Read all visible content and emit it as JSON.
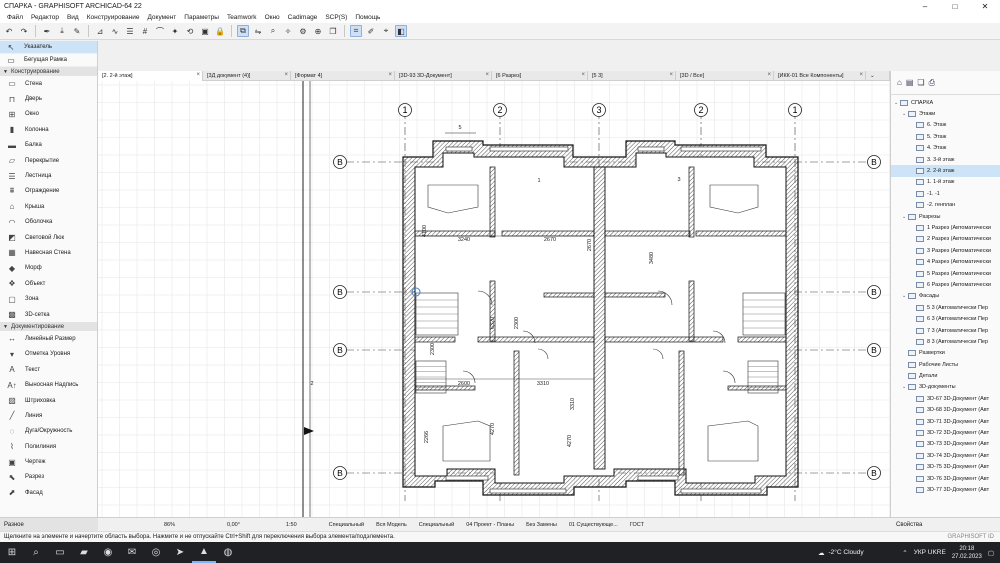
{
  "window": {
    "title": "СПАРКА - GRAPHISOFT ARCHICAD-64 22"
  },
  "menu": [
    "Файл",
    "Редактор",
    "Вид",
    "Конструирование",
    "Документ",
    "Параметры",
    "Teamwork",
    "Окно",
    "Cadimage",
    "SCP(S)",
    "Помощь"
  ],
  "toolbox": {
    "top_items": [
      {
        "label": "Указатель",
        "icon": "arrow-icon"
      },
      {
        "label": "Бегущая Рамка",
        "icon": "marquee-icon"
      }
    ],
    "sections": [
      {
        "title": "Конструирование",
        "items": [
          "Стена",
          "Дверь",
          "Окно",
          "Колонна",
          "Балка",
          "Перекрытие",
          "Лестница",
          "Ограждение",
          "Крыша",
          "Оболочка",
          "Световой Люк",
          "Навесная Стена",
          "Морф",
          "Объект",
          "Зона",
          "3D-сетка"
        ]
      },
      {
        "title": "Документирование",
        "items": [
          "Линейный Размер",
          "Отметка Уровня",
          "Текст",
          "Выносная Надпись",
          "Штриховка",
          "Линия",
          "Дуга/Окружность",
          "Полилиния",
          "Чертеж",
          "Разрез",
          "Фасад"
        ]
      }
    ],
    "footer": "Разное"
  },
  "tabs": [
    {
      "label": "[2. 2-й этаж]",
      "active": true
    },
    {
      "label": "[3Д документ (4)]"
    },
    {
      "label": "[Формат 4]"
    },
    {
      "label": "[3D-93 3D-Документ]"
    },
    {
      "label": "[6 Разрез]"
    },
    {
      "label": "[5 3]"
    },
    {
      "label": "[3D / Все]"
    },
    {
      "label": "[ИКК-01 Все Компоненты]"
    }
  ],
  "navigator": {
    "root": "СПАРКА",
    "items": [
      {
        "label": "Этажи",
        "level": 1,
        "group": true
      },
      {
        "label": "6. Этаж",
        "level": 2
      },
      {
        "label": "5. Этаж",
        "level": 2
      },
      {
        "label": "4. Этаж",
        "level": 2
      },
      {
        "label": "3. 3-й этаж",
        "level": 2
      },
      {
        "label": "2. 2-й этаж",
        "level": 2,
        "selected": true
      },
      {
        "label": "1. 1-й этаж",
        "level": 2
      },
      {
        "label": "-1. -1",
        "level": 2
      },
      {
        "label": "-2. генплан",
        "level": 2
      },
      {
        "label": "Разрезы",
        "level": 1,
        "group": true
      },
      {
        "label": "1 Разрез (Автоматически",
        "level": 2
      },
      {
        "label": "2 Разрез (Автоматически",
        "level": 2
      },
      {
        "label": "3 Разрез (Автоматически",
        "level": 2
      },
      {
        "label": "4 Разрез (Автоматически",
        "level": 2
      },
      {
        "label": "5 Разрез (Автоматически",
        "level": 2
      },
      {
        "label": "6 Разрез (Автоматически",
        "level": 2
      },
      {
        "label": "Фасады",
        "level": 1,
        "group": true
      },
      {
        "label": "5 3 (Автоматически Пер",
        "level": 2
      },
      {
        "label": "6 3 (Автоматически Пер",
        "level": 2
      },
      {
        "label": "7 3 (Автоматически Пер",
        "level": 2
      },
      {
        "label": "8 3 (Автоматически Пер",
        "level": 2
      },
      {
        "label": "Развертки",
        "level": 1
      },
      {
        "label": "Рабочие Листы",
        "level": 1
      },
      {
        "label": "Детали",
        "level": 1
      },
      {
        "label": "3D-документы",
        "level": 1,
        "group": true
      },
      {
        "label": "3D-67 3D-Документ (Авт",
        "level": 2
      },
      {
        "label": "3D-68 3D-Документ (Авт",
        "level": 2
      },
      {
        "label": "3D-71 3D-Документ (Авт",
        "level": 2
      },
      {
        "label": "3D-72 3D-Документ (Авт",
        "level": 2
      },
      {
        "label": "3D-73 3D-Документ (Авт",
        "level": 2
      },
      {
        "label": "3D-74 3D-Документ (Авт",
        "level": 2
      },
      {
        "label": "3D-75 3D-Документ (Авт",
        "level": 2
      },
      {
        "label": "3D-76 3D-Документ (Авт",
        "level": 2
      },
      {
        "label": "3D-77 3D-Документ (Авт",
        "level": 2
      }
    ],
    "footer": "Свойства"
  },
  "statusbar": {
    "zoom": "86%",
    "angle": "0,00°",
    "scale": "1:50",
    "layer": "Специальный",
    "model": "Вся Модель",
    "pen": "Специальный",
    "view": "04 Проект - Планы",
    "override": "Без Замены",
    "reno": "01 Существующе...",
    "standard": "ГОСТ"
  },
  "hint": "Щелкните на элементе и начертите область выбора. Нажмите и не отпускайте Ctrl+Shift для переключения выбора элемента/подэлемента.",
  "brand": "GRAPHISOFT ID",
  "drawing": {
    "axes_top": [
      "1",
      "2",
      "3",
      "2",
      "1"
    ],
    "axes_side": [
      "B",
      "B",
      "B",
      "B",
      "B"
    ],
    "dims": [
      "5",
      "1",
      "3",
      "4100",
      "3240",
      "2670",
      "2670",
      "3480",
      "6320",
      "2300",
      "2300",
      "2600",
      "3310",
      "3310",
      "4270",
      "2266",
      "4270",
      "2"
    ]
  },
  "taskbar": {
    "weather": "-2°C  Cloudy",
    "lang": "УКР UKRE",
    "time": "20:18",
    "date": "27.02.2023"
  }
}
